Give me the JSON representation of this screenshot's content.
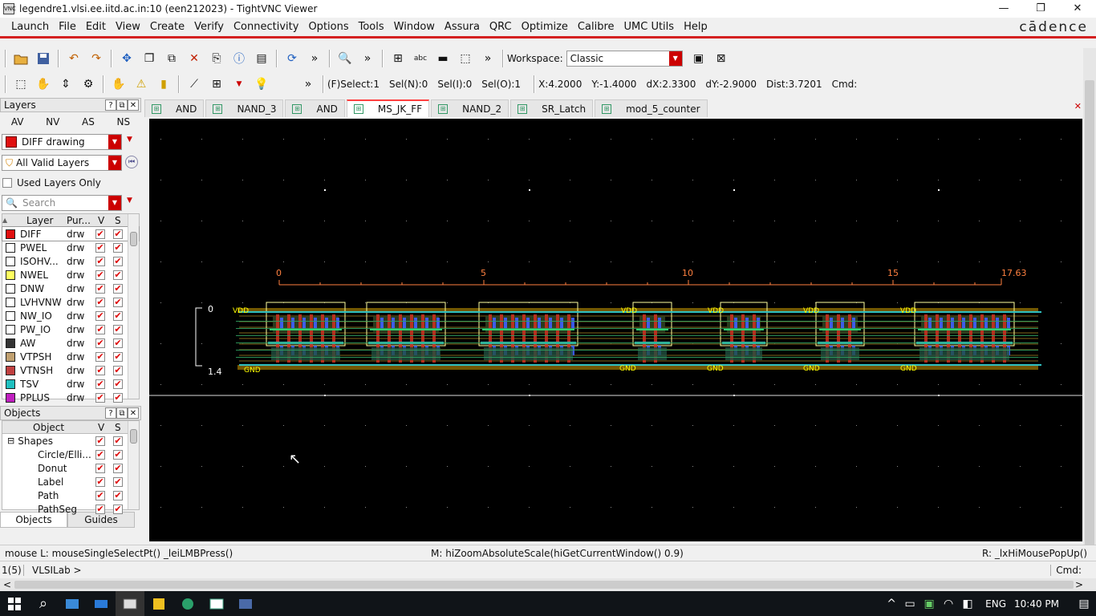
{
  "window": {
    "title": "legendre1.vlsi.ee.iitd.ac.in:10 (een212023) - TightVNC Viewer",
    "vnc_icon": "VNC",
    "minimize": "—",
    "maximize": "❐",
    "close": "✕"
  },
  "menubar": {
    "items": [
      "Launch",
      "File",
      "Edit",
      "View",
      "Create",
      "Verify",
      "Connectivity",
      "Options",
      "Tools",
      "Window",
      "Assura",
      "QRC",
      "Optimize",
      "Calibre",
      "UMC Utils",
      "Help"
    ],
    "brand": "cādence"
  },
  "toolbar1": {
    "workspace_label": "Workspace:",
    "workspace_value": "Classic",
    "more": "»"
  },
  "toolbar2": {
    "more": "»",
    "fselect": "(F)Select:1",
    "seln": "Sel(N):0",
    "seli": "Sel(I):0",
    "selo": "Sel(O):1",
    "x": "X:4.2000",
    "y": "Y:-1.4000",
    "dx": "dX:2.3300",
    "dy": "dY:-2.9000",
    "dist": "Dist:3.7201",
    "cmd": "Cmd:"
  },
  "layers_panel": {
    "title": "Layers",
    "help": "?",
    "float": "⧉",
    "close": "✕",
    "tabs": [
      "AV",
      "NV",
      "AS",
      "NS"
    ],
    "current_layer": "DIFF drawing",
    "filter": "All Valid Layers",
    "used_only": "Used Layers Only",
    "search_placeholder": "Search",
    "headers": [
      "Layer",
      "Pur...",
      "V",
      "S"
    ],
    "rows": [
      {
        "name": "DIFF",
        "pur": "drw",
        "color": "#e01010"
      },
      {
        "name": "PWEL",
        "pur": "drw",
        "color": "#ffffff"
      },
      {
        "name": "ISOHV...",
        "pur": "drw",
        "color": "#ffffff"
      },
      {
        "name": "NWEL",
        "pur": "drw",
        "color": "#ffff60"
      },
      {
        "name": "DNW",
        "pur": "drw",
        "color": "#ffffff"
      },
      {
        "name": "LVHVNW",
        "pur": "drw",
        "color": "#ffffff"
      },
      {
        "name": "NW_IO",
        "pur": "drw",
        "color": "#ffffff"
      },
      {
        "name": "PW_IO",
        "pur": "drw",
        "color": "#ffffff"
      },
      {
        "name": "AW",
        "pur": "drw",
        "color": "#333333"
      },
      {
        "name": "VTPSH",
        "pur": "drw",
        "color": "#c0a070"
      },
      {
        "name": "VTNSH",
        "pur": "drw",
        "color": "#c04040"
      },
      {
        "name": "TSV",
        "pur": "drw",
        "color": "#20c0c0"
      },
      {
        "name": "PPLUS",
        "pur": "drw",
        "color": "#c020c0"
      }
    ],
    "check": "✔"
  },
  "objects_panel": {
    "title": "Objects",
    "headers": [
      "Object",
      "V",
      "S"
    ],
    "rows": [
      {
        "name": "Shapes",
        "expander": "⊟"
      },
      {
        "name": "Circle/Elli..."
      },
      {
        "name": "Donut"
      },
      {
        "name": "Label"
      },
      {
        "name": "Path"
      },
      {
        "name": "PathSeg"
      }
    ],
    "bottom_tabs": [
      "Objects",
      "Guides"
    ]
  },
  "doc_tabs": [
    "AND",
    "NAND_3",
    "AND",
    "MS_JK_FF",
    "NAND_2",
    "SR_Latch",
    "mod_5_counter"
  ],
  "active_tab": 3,
  "tab_close": "✕",
  "canvas": {
    "ruler_labels": [
      "0",
      "5",
      "10",
      "15",
      "17.63"
    ],
    "vruler_top": "0",
    "vruler_bottom": "1.4",
    "net_labels_top": [
      "VDD",
      "VDD",
      "VDD",
      "VDD",
      "VDD"
    ],
    "net_labels_bottom": [
      "GND",
      "GND",
      "GND",
      "GND",
      "GND"
    ],
    "cursor": "↖"
  },
  "status": {
    "mouse_l": "mouse L: mouseSingleSelectPt() _leiLMBPress()",
    "mouse_m": "M: hiZoomAbsoluteScale(hiGetCurrentWindow() 0.9)",
    "mouse_r": "R: _lxHiMousePopUp()",
    "counter": "1(5)",
    "prompt": "VLSILab >",
    "cmd": "Cmd:"
  },
  "scroll": {
    "left": "<",
    "right": ">",
    "up": "▲",
    "down": "▼"
  },
  "taskbar": {
    "lang": "ENG",
    "time": "10:40 PM",
    "search_icon": "⌕",
    "tray_up": "^"
  }
}
